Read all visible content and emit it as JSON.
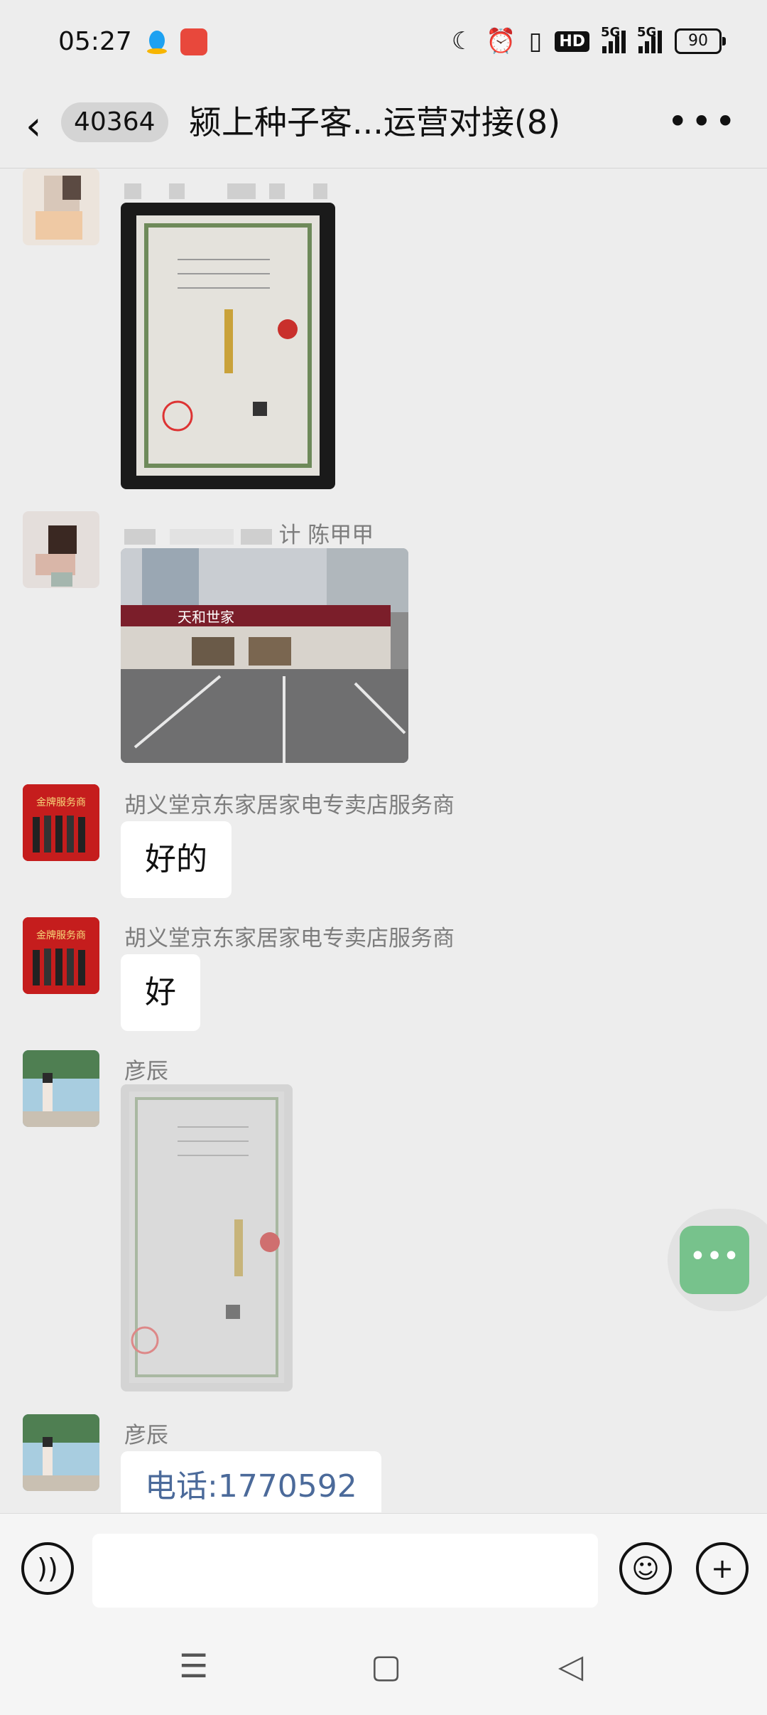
{
  "status_bar": {
    "time": "05:27",
    "icons": [
      "qq-icon",
      "dangdang-icon",
      "moon-icon",
      "alarm-icon",
      "vibrate-icon",
      "hd-icon",
      "signal-5g-icon",
      "signal-5g-icon",
      "battery-icon"
    ],
    "hd_label": "HD",
    "network_label": "5G",
    "battery_level": "90"
  },
  "header": {
    "unread_count": "40364",
    "title": "颍上种子客...运营对接(8)"
  },
  "messages": [
    {
      "type": "image",
      "sender": "",
      "image": "business-license-photo"
    },
    {
      "type": "image",
      "sender": "计 陈甲甲",
      "image": "storefront-photo",
      "store_sign": "天和世家"
    },
    {
      "type": "text",
      "sender": "胡义堂京东家居家电专卖店服务商",
      "text": "好的",
      "avatar_caption": "金牌服务商"
    },
    {
      "type": "text",
      "sender": "胡义堂京东家居家电专卖店服务商",
      "text": "好",
      "avatar_caption": "金牌服务商"
    },
    {
      "type": "image",
      "sender": "彦辰",
      "image": "business-license-photo"
    },
    {
      "type": "text",
      "sender": "彦辰",
      "text": "电话:1770592"
    }
  ],
  "input": {
    "placeholder": ""
  },
  "colors": {
    "background": "#ededed",
    "float_button": "#77c28c",
    "bubble": "#ffffff"
  }
}
